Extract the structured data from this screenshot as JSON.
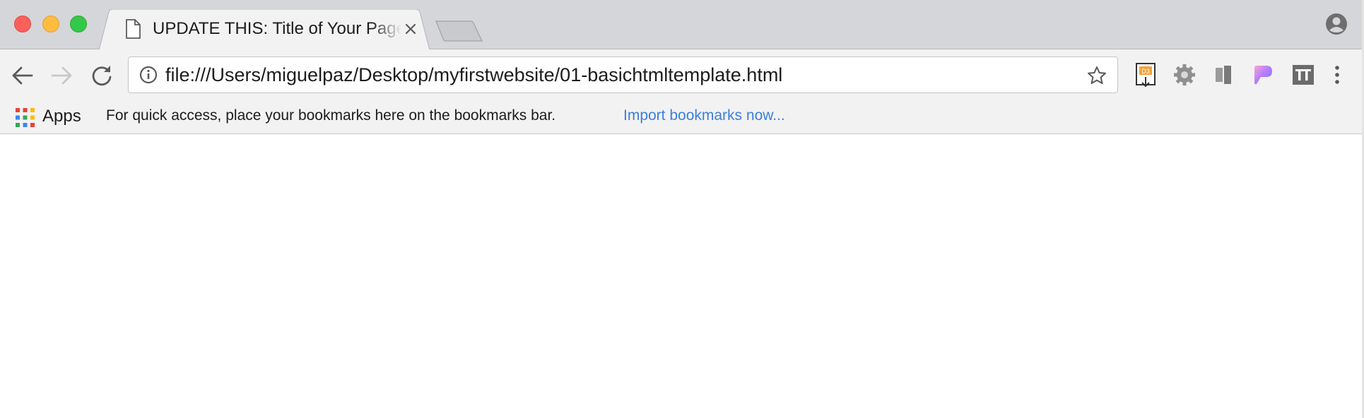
{
  "browser": {
    "window_controls": [
      "close",
      "minimize",
      "maximize"
    ],
    "active_tab": {
      "title": "UPDATE THIS: Title of Your Page",
      "icon": "document-icon",
      "close_icon": "close-icon"
    },
    "new_tab_icon": "new-tab-icon",
    "profile_icon": "profile-icon"
  },
  "toolbar": {
    "back_icon": "arrow-left-icon",
    "forward_icon": "arrow-right-icon",
    "reload_icon": "reload-icon",
    "address": {
      "info_icon": "info-icon",
      "url": "file:///Users/miguelpaz/Desktop/myfirstwebsite/01-basichtmltemplate.html",
      "bookmark_icon": "star-icon"
    },
    "extensions": [
      "d3-extension-icon",
      "gear-extension-icon",
      "panels-extension-icon",
      "paper-extension-icon",
      "ti-extension-icon"
    ],
    "menu_icon": "kebab-menu-icon"
  },
  "bookmarks_bar": {
    "apps_label": "Apps",
    "hint": "For quick access, place your bookmarks here on the bookmarks bar.",
    "import_link": "Import bookmarks now..."
  },
  "colors": {
    "close": "#fc605b",
    "minimize": "#fdbc40",
    "maximize": "#34c84a",
    "link": "#3b7fdc",
    "chrome_bg": "#f2f2f2",
    "tabstrip_bg": "#d5d6d9"
  }
}
